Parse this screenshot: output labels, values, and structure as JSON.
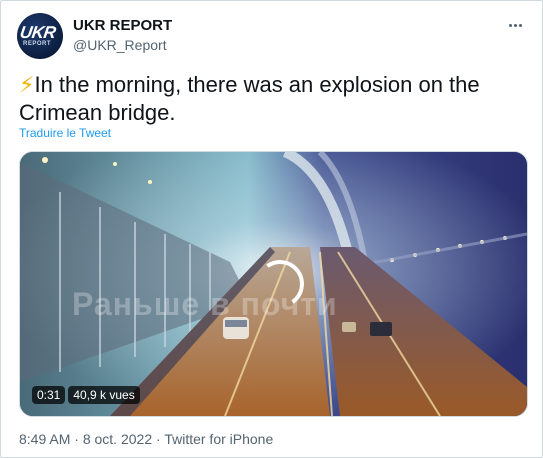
{
  "account": {
    "name": "UKR REPORT",
    "handle": "@UKR_Report",
    "avatar_text": "UKR",
    "avatar_sub": "REPORT"
  },
  "tweet": {
    "emoji": "⚡",
    "text": "In the morning, there was an explosion on the Crimean bridge.",
    "translate_label": "Traduire le Tweet"
  },
  "media": {
    "overlay_caption": "Раньше в    почти",
    "duration": "0:31",
    "views": "40,9 k vues"
  },
  "meta": {
    "time": "8:49 AM",
    "date": "8 oct. 2022",
    "source": "Twitter for iPhone",
    "separator": " · "
  },
  "colors": {
    "link": "#1d9bf0",
    "secondary_text": "#536471",
    "primary_text": "#0f1419"
  },
  "icons": [
    "more-options-icon",
    "loading-spinner-icon"
  ]
}
